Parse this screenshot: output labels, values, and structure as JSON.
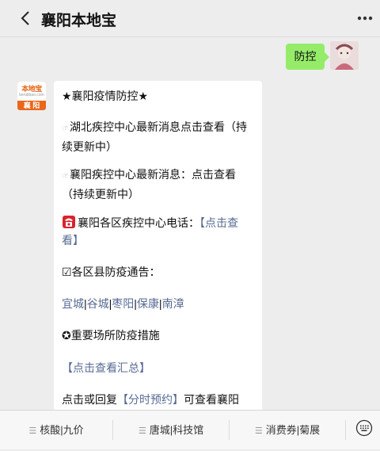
{
  "header": {
    "title": "襄阳本地宝"
  },
  "outgoing": {
    "text": "防控"
  },
  "bot_avatar": {
    "logo": "本地宝",
    "logo_sub": "bendibao.com",
    "city": "襄 阳"
  },
  "message": {
    "line1": "★襄阳疫情防控★",
    "p2": "湖北疾控中心最新消息点击查看（持续更新中）",
    "p3": "襄阳疾控中心最新消息：点击查看（持续更新中）",
    "p4_text": "襄阳各区疾控中心电话：",
    "p4_link": "【点击查看】",
    "p5": "☑各区县防疫通告：",
    "districts": [
      "宜城",
      "谷城",
      "枣阳",
      "保康",
      "南漳"
    ],
    "p7": "✪重要场所防疫措施",
    "p8_link": "【点击查看汇总】",
    "p9_pre": "点击或回复",
    "p9_link": "【分时预约】",
    "p9_post": "可查看襄阳"
  },
  "menu": {
    "items": [
      "核酸|九价",
      "唐城|科技馆",
      "消费券|菊展"
    ]
  },
  "colors": {
    "background": "#ededed",
    "outgoing_bubble": "#95ec69",
    "link": "#576b95",
    "brand": "#e8671b"
  }
}
